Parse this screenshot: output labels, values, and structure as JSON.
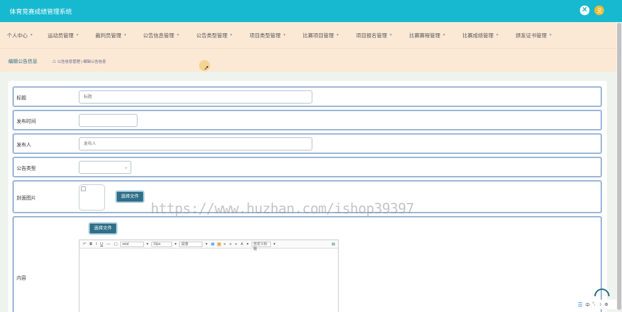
{
  "app": {
    "title": "体育竞赛成绩管理系统"
  },
  "top_icons": {
    "close": "close-icon",
    "user": "user-avatar-icon"
  },
  "nav": [
    {
      "label": "个人中心"
    },
    {
      "label": "运动员管理"
    },
    {
      "label": "裁判员管理"
    },
    {
      "label": "公告信息管理"
    },
    {
      "label": "公告类型管理"
    },
    {
      "label": "项目类型管理"
    },
    {
      "label": "比赛项目管理"
    },
    {
      "label": "项目报名管理"
    },
    {
      "label": "比赛赛程管理"
    },
    {
      "label": "比赛成绩管理"
    },
    {
      "label": "颁发证书管理"
    }
  ],
  "breadcrumb": {
    "title": "编辑公告信息",
    "path": "公告信息管理 | 编辑公告信息"
  },
  "form": {
    "title": {
      "label": "标题",
      "placeholder": "标题"
    },
    "publish_time": {
      "label": "发布时间",
      "value": ""
    },
    "publisher": {
      "label": "发布人",
      "placeholder": "发布人"
    },
    "type": {
      "label": "公告类型",
      "value": ""
    },
    "cover": {
      "label": "封面图片",
      "button": "选择文件"
    },
    "content": {
      "label": "内容",
      "button": "选择文件"
    }
  },
  "editor": {
    "font_name": "arial",
    "font_size": "16px",
    "paragraph": "段落",
    "custom_title": "自定义标题"
  },
  "watermark": "https://www.huzhan.com/ishop39397",
  "ime": {
    "lang": "中"
  },
  "colors": {
    "topbar": "#16b9cf",
    "navbar": "#fbe9d6",
    "accent": "#2f6f87",
    "border": "#9ab5d5"
  }
}
